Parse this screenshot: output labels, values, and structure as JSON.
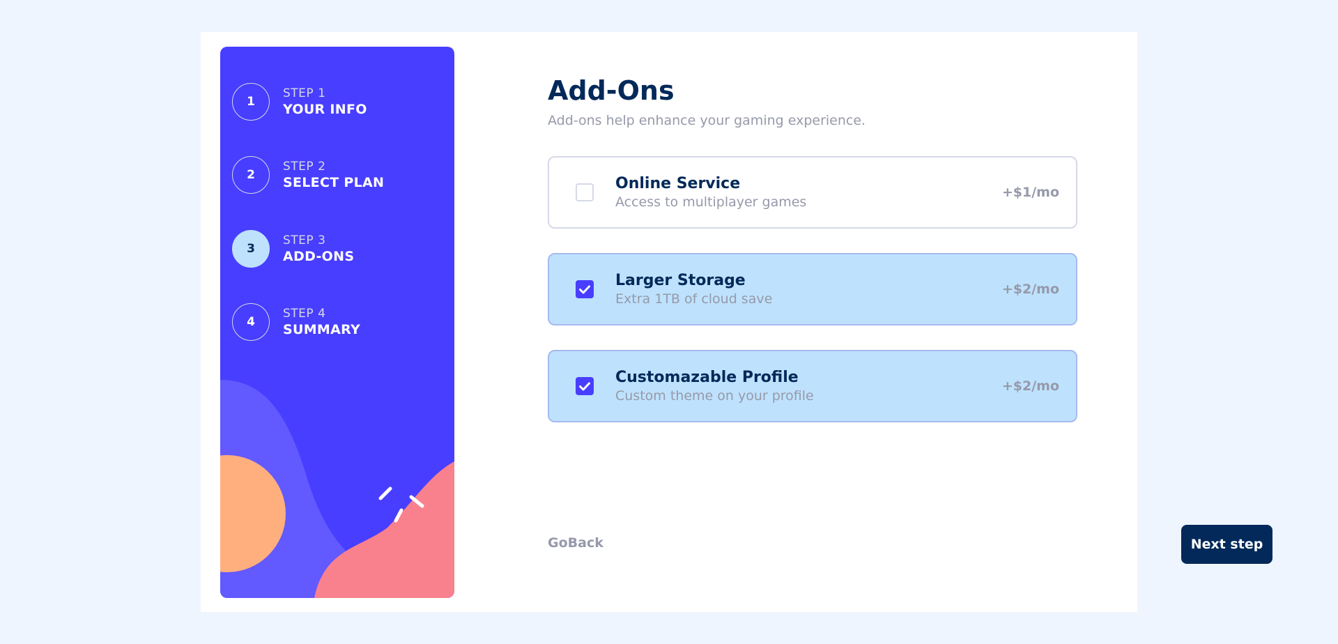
{
  "sidebar": {
    "steps": [
      {
        "number": "1",
        "label": "STEP 1",
        "name": "YOUR INFO",
        "active": false
      },
      {
        "number": "2",
        "label": "STEP 2",
        "name": "SELECT PLAN",
        "active": false
      },
      {
        "number": "3",
        "label": "STEP 3",
        "name": "ADD-ONS",
        "active": true
      },
      {
        "number": "4",
        "label": "STEP 4",
        "name": "SUMMARY",
        "active": false
      }
    ]
  },
  "main": {
    "title": "Add-Ons",
    "subtitle": "Add-ons help enhance your gaming experience.",
    "addons": [
      {
        "name": "Online Service",
        "description": "Access to multiplayer games",
        "price": "+$1/mo",
        "checked": false
      },
      {
        "name": "Larger Storage",
        "description": "Extra 1TB of cloud save",
        "price": "+$2/mo",
        "checked": true
      },
      {
        "name": "Customazable Profile",
        "description": "Custom theme on your profile",
        "price": "+$2/mo",
        "checked": true
      }
    ]
  },
  "footer": {
    "back_label": "GoBack",
    "next_label": "Next step"
  },
  "colors": {
    "page_bg": "#eff5ff",
    "sidebar_bg": "#483eff",
    "primary_text": "#022959",
    "muted_text": "#9699aa",
    "selected_bg": "#bee2fd",
    "accent": "#483eff"
  }
}
